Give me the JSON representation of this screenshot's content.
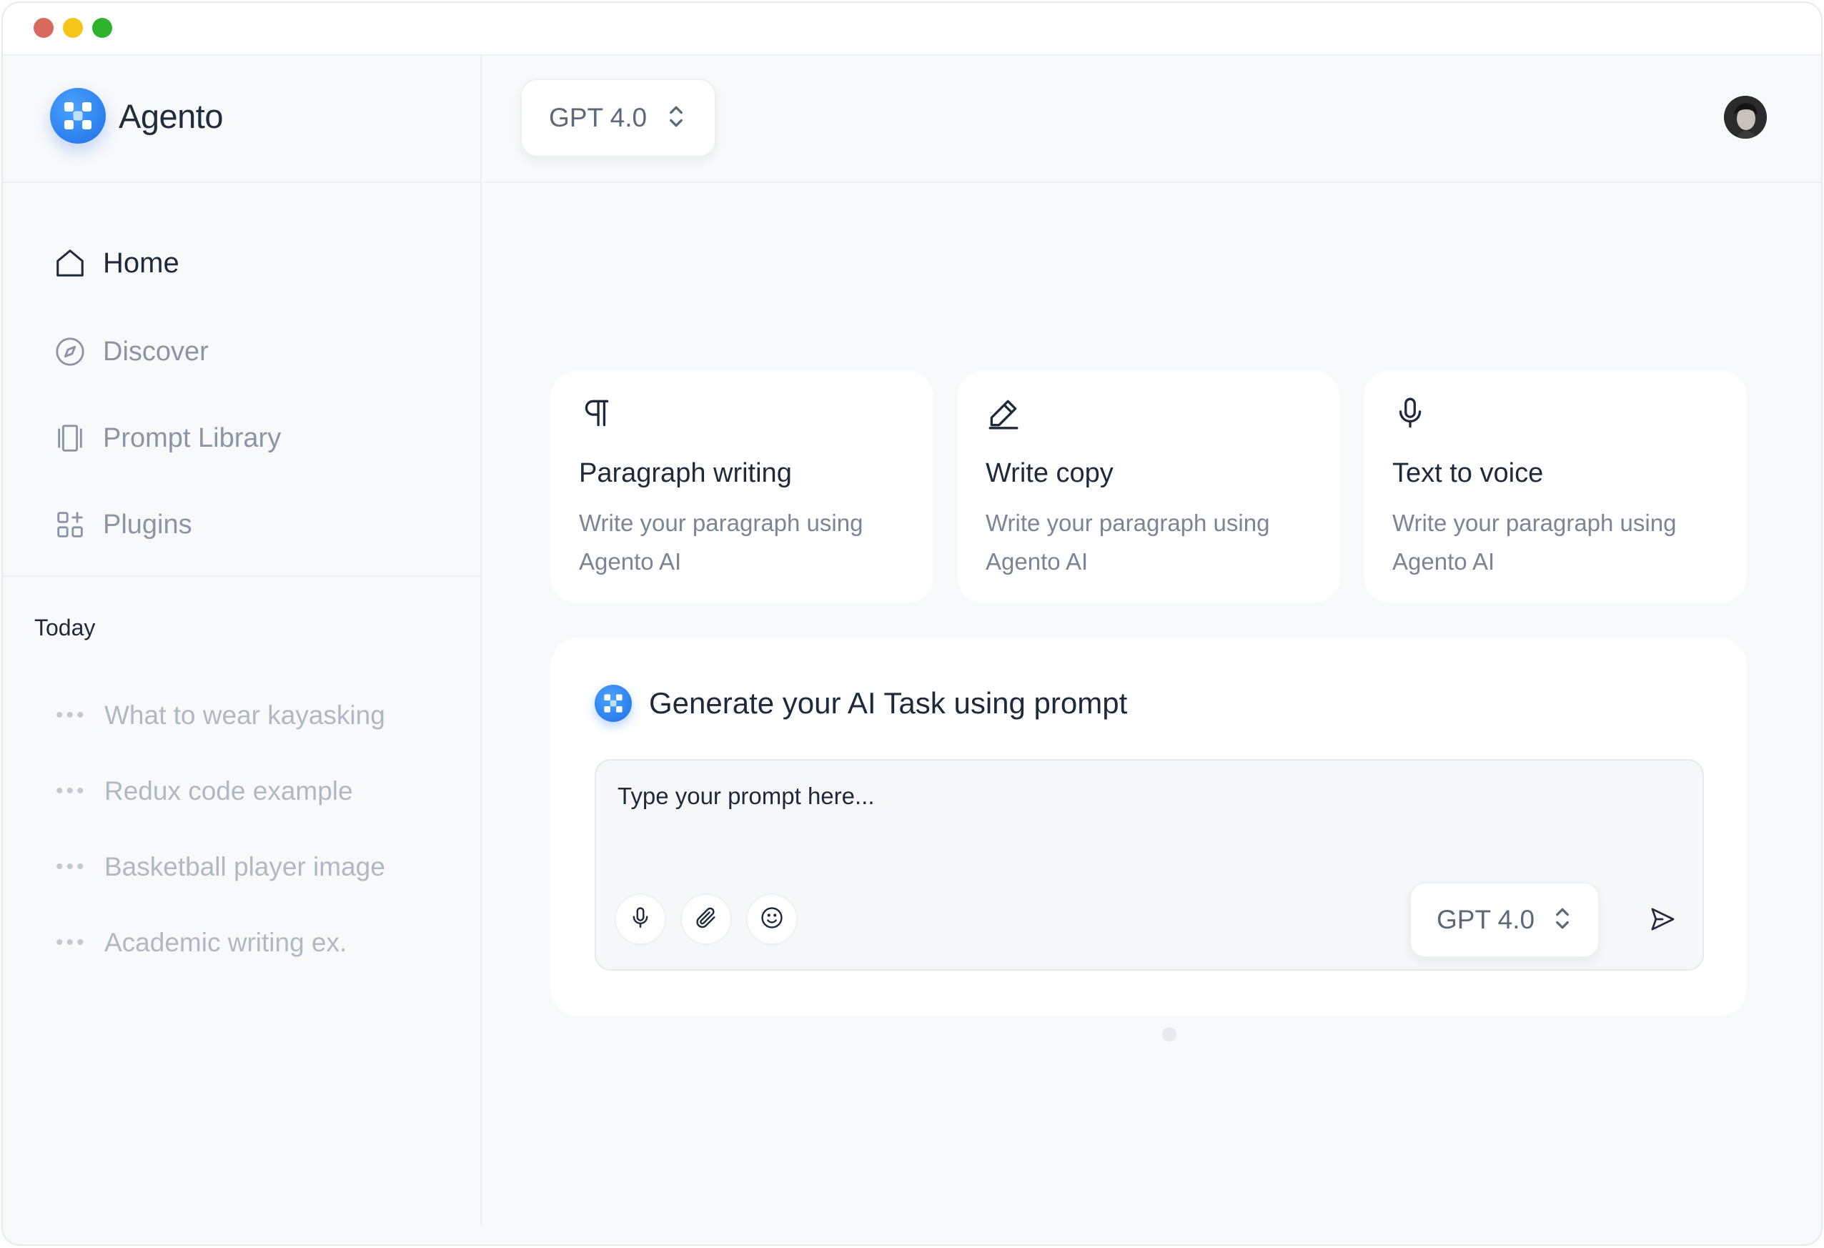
{
  "app": {
    "name": "Agento"
  },
  "window": {
    "controls": [
      "close",
      "minimize",
      "maximize"
    ]
  },
  "header": {
    "model_selector": {
      "value": "GPT 4.0",
      "icon": "chevron-up-down-icon"
    },
    "avatar": {
      "icon": "user-avatar"
    }
  },
  "sidebar": {
    "nav": [
      {
        "label": "Home",
        "icon": "home-icon",
        "active": true
      },
      {
        "label": "Discover",
        "icon": "compass-icon",
        "active": false
      },
      {
        "label": "Prompt Library",
        "icon": "library-icon",
        "active": false
      },
      {
        "label": "Plugins",
        "icon": "plugins-icon",
        "active": false
      }
    ],
    "history_heading": "Today",
    "history": [
      {
        "label": "What to wear kayasking",
        "icon": "more-dots-icon"
      },
      {
        "label": "Redux code example",
        "icon": "more-dots-icon"
      },
      {
        "label": "Basketball player image",
        "icon": "more-dots-icon"
      },
      {
        "label": "Academic writing ex.",
        "icon": "more-dots-icon"
      }
    ]
  },
  "cards": [
    {
      "title": "Paragraph writing",
      "description": "Write your paragraph using Agento AI",
      "icon": "pilcrow-icon"
    },
    {
      "title": "Write copy",
      "description": "Write your paragraph using Agento AI",
      "icon": "pencil-icon"
    },
    {
      "title": "Text to voice",
      "description": "Write your paragraph using Agento AI",
      "icon": "microphone-icon"
    }
  ],
  "prompt": {
    "title": "Generate your AI Task using prompt",
    "placeholder": "Type your prompt here...",
    "tools": [
      "microphone-icon",
      "paperclip-icon",
      "smile-icon"
    ],
    "model_selector": {
      "value": "GPT 4.0",
      "icon": "chevron-up-down-icon"
    },
    "send_icon": "send-icon"
  },
  "colors": {
    "accent": "#1f6fe5",
    "text_primary": "#1e2a3b",
    "text_muted": "#8a95a5",
    "background": "#f8f9fb",
    "card": "#ffffff"
  }
}
